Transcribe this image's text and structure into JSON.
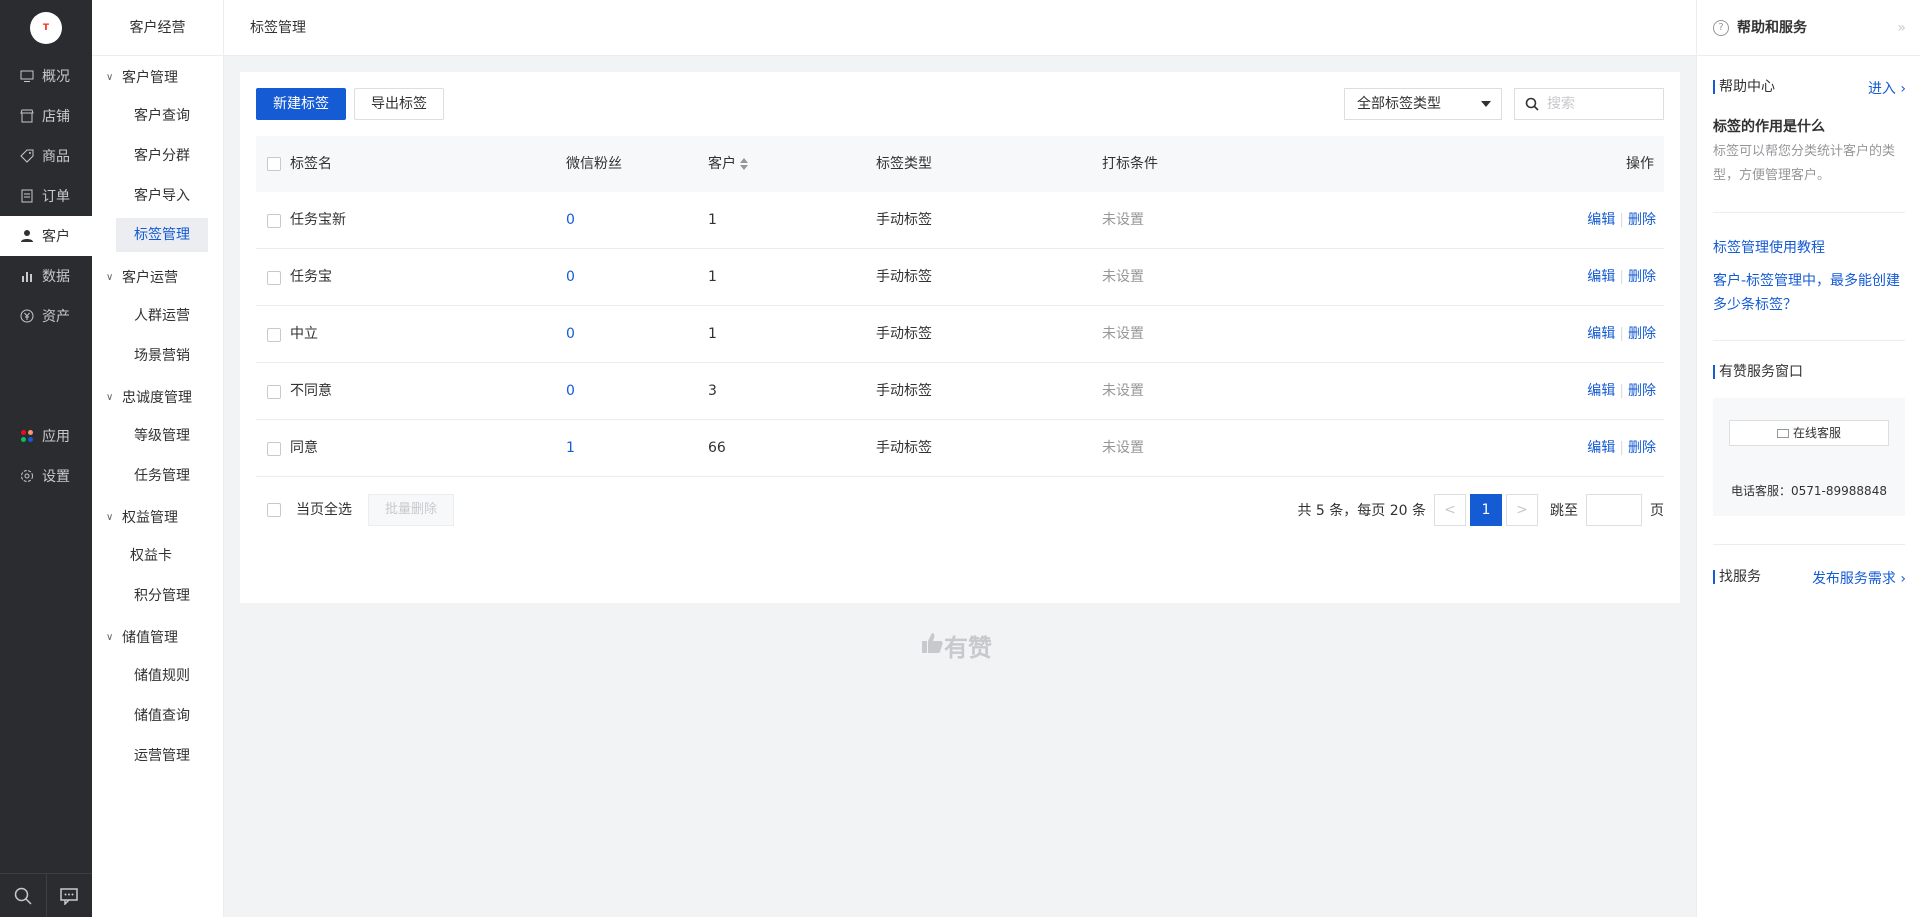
{
  "rail": {
    "logo_text": "T",
    "items": [
      {
        "label": "概况",
        "icon": "monitor-icon"
      },
      {
        "label": "店铺",
        "icon": "store-icon"
      },
      {
        "label": "商品",
        "icon": "tag-icon"
      },
      {
        "label": "订单",
        "icon": "order-icon"
      },
      {
        "label": "客户",
        "icon": "user-icon"
      },
      {
        "label": "数据",
        "icon": "chart-icon"
      },
      {
        "label": "资产",
        "icon": "yuan-icon"
      },
      {
        "label": "应用",
        "icon": "apps-icon"
      },
      {
        "label": "设置",
        "icon": "gear-icon"
      }
    ]
  },
  "subnav": {
    "title": "客户经营",
    "groups": [
      {
        "label": "客户管理",
        "items": [
          "客户查询",
          "客户分群",
          "客户导入",
          "标签管理"
        ]
      },
      {
        "label": "客户运营",
        "items": [
          "人群运营",
          "场景营销"
        ]
      },
      {
        "label": "忠诚度管理",
        "items": [
          "等级管理",
          "任务管理"
        ]
      },
      {
        "label": "权益管理",
        "items": [
          "权益卡",
          "积分管理"
        ]
      },
      {
        "label": "储值管理",
        "items": [
          "储值规则",
          "储值查询",
          "运营管理"
        ]
      }
    ]
  },
  "topbar": {
    "title": "标签管理"
  },
  "toolbar": {
    "new_label": "新建标签",
    "export_label": "导出标签",
    "type_filter": "全部标签类型",
    "search_placeholder": "搜索"
  },
  "table": {
    "headers": {
      "name": "标签名",
      "wechat": "微信粉丝",
      "customers": "客户",
      "type": "标签类型",
      "condition": "打标条件",
      "ops": "操作"
    },
    "rows": [
      {
        "name": "任务宝新",
        "wechat": "0",
        "customers": "1",
        "type": "手动标签",
        "condition": "未设置"
      },
      {
        "name": "任务宝",
        "wechat": "0",
        "customers": "1",
        "type": "手动标签",
        "condition": "未设置"
      },
      {
        "name": "中立",
        "wechat": "0",
        "customers": "1",
        "type": "手动标签",
        "condition": "未设置"
      },
      {
        "name": "不同意",
        "wechat": "0",
        "customers": "3",
        "type": "手动标签",
        "condition": "未设置"
      },
      {
        "name": "同意",
        "wechat": "1",
        "customers": "66",
        "type": "手动标签",
        "condition": "未设置"
      }
    ],
    "edit_label": "编辑",
    "delete_label": "删除"
  },
  "footer": {
    "select_all": "当页全选",
    "batch_delete": "批量删除",
    "summary": "共 5 条，每页 20 条",
    "current_page": "1",
    "jump_label": "跳至",
    "page_suffix": "页"
  },
  "brand": "有赞",
  "help": {
    "title": "帮助和服务",
    "center_title": "帮助中心",
    "center_link": "进入",
    "question": "标签的作用是什么",
    "answer": "标签可以帮您分类统计客户的类型，方便管理客户。",
    "articles": [
      "标签管理使用教程",
      "客户-标签管理中，最多能创建多少条标签？"
    ],
    "service_title": "有赞服务窗口",
    "online_service": "在线客服",
    "phone": "电话客服：0571-89988848",
    "find_title": "找服务",
    "find_link": "发布服务需求"
  },
  "colors": {
    "accent": "#155bd4",
    "rail_bg": "#2a2c30"
  }
}
